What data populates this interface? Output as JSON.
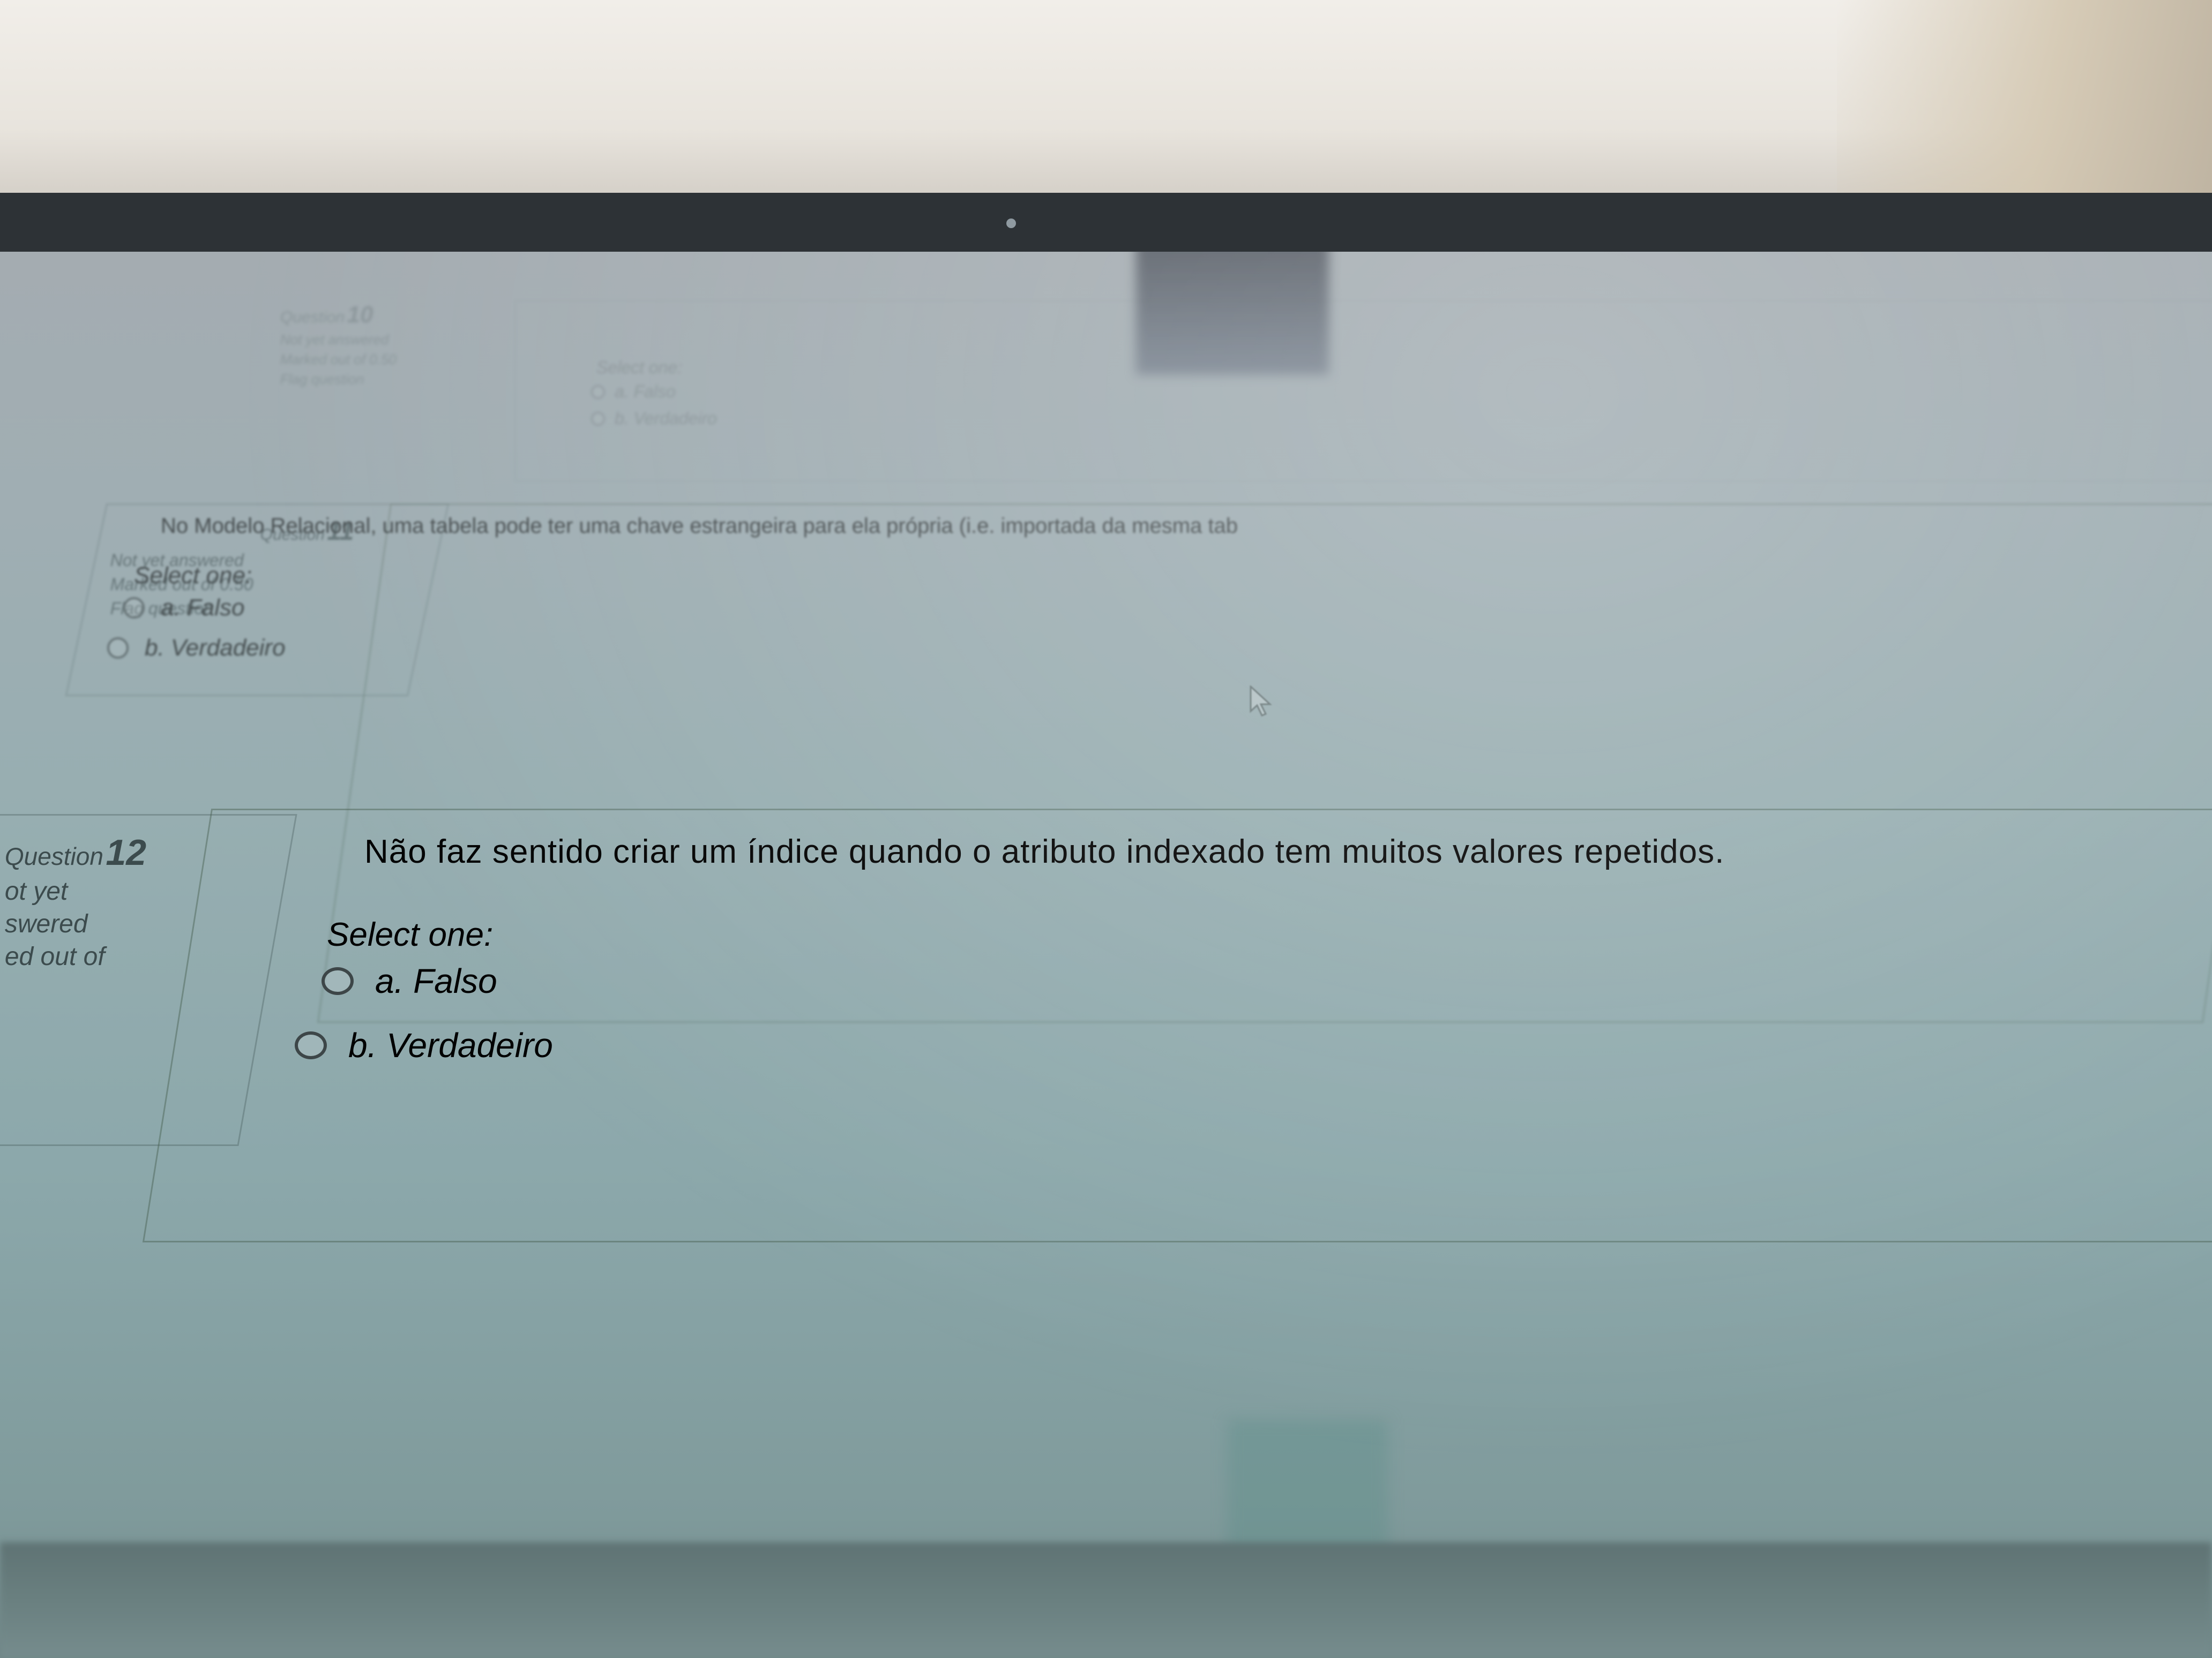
{
  "quiz": {
    "questions": [
      {
        "label": "Question",
        "number": "10",
        "status": "Not yet answered",
        "marked": "Marked out of 0.50",
        "flag": "Flag question",
        "text": "",
        "select_label": "Select one:",
        "options": [
          "a. Falso",
          "b. Verdadeiro"
        ]
      },
      {
        "label": "Question",
        "number": "11",
        "status": "Not yet answered",
        "marked": "Marked out of 0.50",
        "flag": "Flag question",
        "text": "No Modelo Relacional, uma tabela pode ter uma chave estrangeira para ela própria (i.e. importada da mesma tab",
        "select_label": "Select one:",
        "options": [
          "a. Falso",
          "b. Verdadeiro"
        ]
      },
      {
        "label": "Question",
        "number": "12",
        "status_line1": "ot yet",
        "status_line2": "swered",
        "marked": "ed out of",
        "text": "Não faz sentido criar um índice quando o atributo indexado tem muitos valores repetidos.",
        "select_label": "Select one:",
        "options": [
          "a. Falso",
          "b. Verdadeiro"
        ]
      }
    ]
  },
  "icons": {
    "cursor": "mouse-pointer-icon",
    "flag": "flag-icon"
  },
  "colors": {
    "screen_bg": "#97aeb1",
    "text": "#3c4446",
    "border": "#5f7a6a"
  }
}
